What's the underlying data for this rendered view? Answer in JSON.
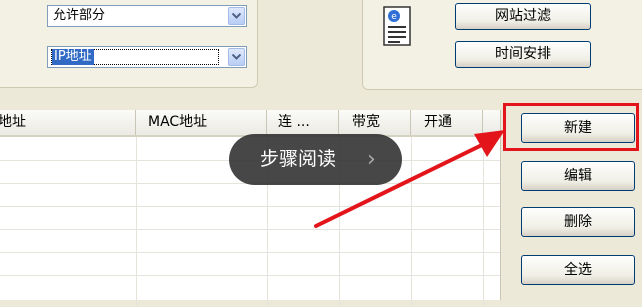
{
  "filter": {
    "permission_value": "允许部分",
    "filter_type_value": "IP地址"
  },
  "buttons": {
    "site_filter": "网站过滤",
    "schedule": "时间安排",
    "new": "新建",
    "edit": "编辑",
    "delete": "删除",
    "select_all": "全选"
  },
  "table": {
    "columns": [
      "地址",
      "MAC地址",
      "连 ...",
      "带宽",
      "开通"
    ]
  },
  "overlay": {
    "label": "步骤阅读",
    "chevron": "›"
  },
  "colors": {
    "highlight": "#e3141a",
    "selection": "#316ac5",
    "button_border": "#003c74"
  }
}
